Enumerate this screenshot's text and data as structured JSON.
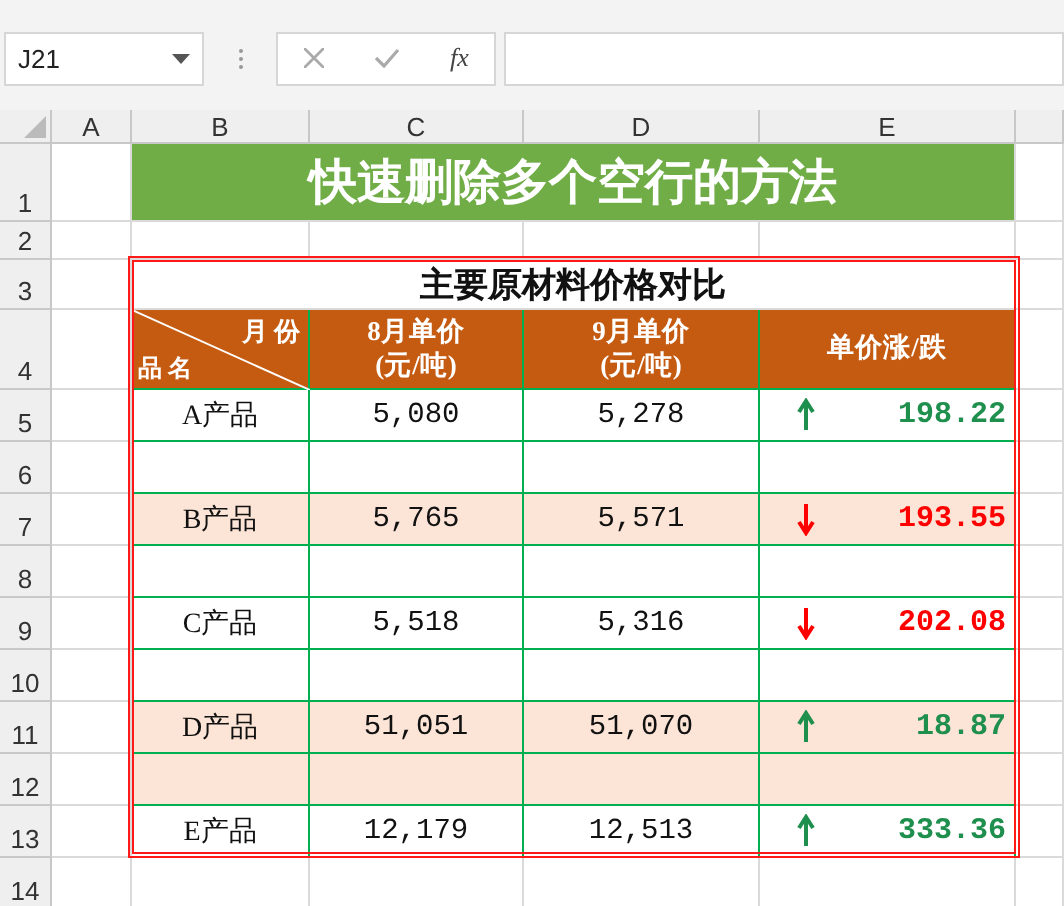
{
  "name_box": {
    "value": "J21"
  },
  "formula_bar": {
    "function_label": "fx"
  },
  "column_headers": [
    "A",
    "B",
    "C",
    "D",
    "E"
  ],
  "row_numbers": [
    "1",
    "2",
    "3",
    "4",
    "5",
    "6",
    "7",
    "8",
    "9",
    "10",
    "11",
    "12",
    "13",
    "14"
  ],
  "title": "快速删除多个空行的方法",
  "table": {
    "title": "主要原材料价格对比",
    "corner_top": "月 份",
    "corner_bottom": "品 名",
    "columns": [
      "8月单价\n(元/吨)",
      "9月单价\n(元/吨)",
      "单价涨/跌"
    ],
    "rows": [
      {
        "kind": "data",
        "highlighted": false,
        "product": "A产品",
        "aug": "5,080",
        "sep": "5,278",
        "rising": true,
        "change": "198.22"
      },
      {
        "kind": "blank",
        "highlighted": false
      },
      {
        "kind": "data",
        "highlighted": true,
        "product": "B产品",
        "aug": "5,765",
        "sep": "5,571",
        "rising": false,
        "change": "193.55"
      },
      {
        "kind": "blank",
        "highlighted": false
      },
      {
        "kind": "data",
        "highlighted": false,
        "product": "C产品",
        "aug": "5,518",
        "sep": "5,316",
        "rising": false,
        "change": "202.08"
      },
      {
        "kind": "blank",
        "highlighted": false
      },
      {
        "kind": "data",
        "highlighted": true,
        "product": "D产品",
        "aug": "51,051",
        "sep": "51,070",
        "rising": true,
        "change": "18.87"
      },
      {
        "kind": "blank",
        "highlighted": true
      },
      {
        "kind": "data",
        "highlighted": false,
        "product": "E产品",
        "aug": "12,179",
        "sep": "12,513",
        "rising": true,
        "change": "333.36"
      }
    ]
  }
}
